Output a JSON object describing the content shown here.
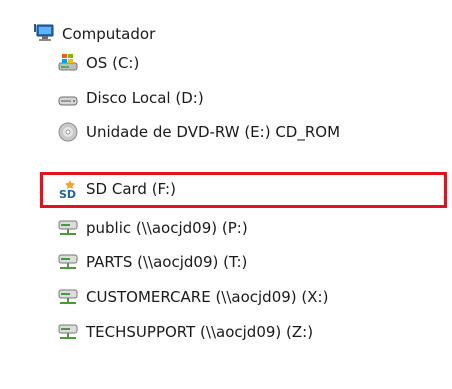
{
  "tree": {
    "root": {
      "label": "Computador",
      "icon": "computer-icon"
    },
    "items": [
      {
        "label": "OS (C:)",
        "icon": "windows-drive-icon"
      },
      {
        "label": "Disco Local (D:)",
        "icon": "hard-drive-icon"
      },
      {
        "label": "Unidade de DVD-RW (E:) CD_ROM",
        "icon": "dvd-drive-icon"
      },
      {
        "label": "SD Card (F:)",
        "icon": "sd-card-icon",
        "highlighted": true
      },
      {
        "label": "public (\\\\aocjd09) (P:)",
        "icon": "network-drive-icon"
      },
      {
        "label": "PARTS (\\\\aocjd09) (T:)",
        "icon": "network-drive-icon"
      },
      {
        "label": "CUSTOMERCARE (\\\\aocjd09) (X:)",
        "icon": "network-drive-icon"
      },
      {
        "label": "TECHSUPPORT (\\\\aocjd09) (Z:)",
        "icon": "network-drive-icon"
      }
    ]
  },
  "colors": {
    "highlight_border": "#e0121c",
    "text": "#1a1a1a"
  }
}
